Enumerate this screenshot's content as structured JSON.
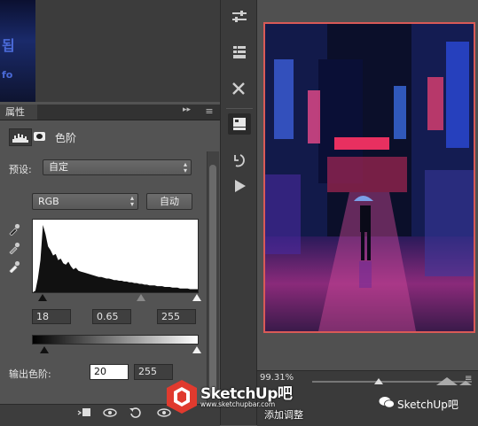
{
  "thumbnail": {
    "text_top": "됩",
    "text_bottom": "fo"
  },
  "panel": {
    "tab_label": "属性",
    "collapse_glyph": "▸▸",
    "menu_glyph": "≡",
    "adjustment_title": "色阶",
    "preset_label": "预设:",
    "preset_value": "自定",
    "channel_value": "RGB",
    "auto_button": "自动",
    "input_levels": {
      "black": "18",
      "gamma": "0.65",
      "white": "255"
    },
    "output_label": "输出色阶:",
    "output_levels": {
      "low": "20",
      "high": "255"
    }
  },
  "histogram": {
    "type": "area",
    "x_range": [
      0,
      255
    ],
    "values": [
      0,
      2,
      18,
      42,
      88,
      76,
      60,
      55,
      48,
      50,
      42,
      44,
      38,
      36,
      40,
      34,
      30,
      32,
      28,
      27,
      26,
      25,
      24,
      23,
      22,
      21,
      20,
      20,
      19,
      18,
      18,
      17,
      16,
      16,
      15,
      15,
      14,
      14,
      13,
      13,
      12,
      12,
      11,
      11,
      10,
      10,
      9,
      9,
      9,
      8,
      8,
      8,
      7,
      7,
      7,
      6,
      6,
      6,
      5,
      5,
      5,
      5,
      4,
      4,
      4,
      4
    ]
  },
  "status": {
    "zoom": "99.31%"
  },
  "watermark": {
    "brand": "SketchUp吧",
    "url": "www.sketchupbar.com",
    "add_text": "添加调整",
    "wechat": "SketchUp吧"
  },
  "colors": {
    "panel_bg": "#535353",
    "dark_bg": "#3b3b3b",
    "photo_border": "#d95a57"
  }
}
